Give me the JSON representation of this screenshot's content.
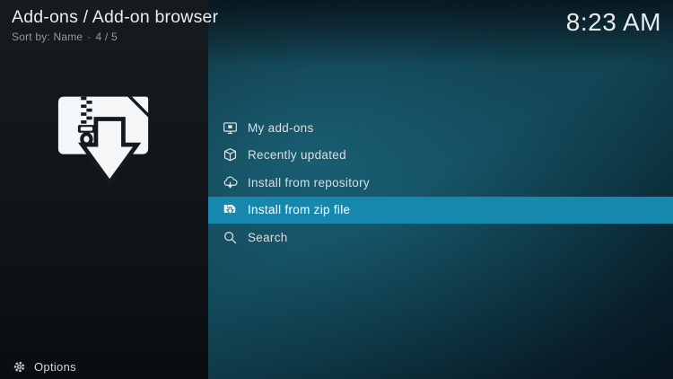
{
  "window": {
    "title": "Add-ons / Add-on browser",
    "sort_label": "Sort by: Name",
    "separator": "·",
    "position_indicator": "4 / 5",
    "clock": "8:23 AM"
  },
  "artwork": {
    "icon": "zip-file-download-icon"
  },
  "menu": {
    "items": [
      {
        "label": "My add-ons",
        "icon": "my-addons-icon",
        "selected": false
      },
      {
        "label": "Recently updated",
        "icon": "recently-updated-icon",
        "selected": false
      },
      {
        "label": "Install from repository",
        "icon": "install-from-repository-icon",
        "selected": false
      },
      {
        "label": "Install from zip file",
        "icon": "install-from-zip-icon",
        "selected": true
      },
      {
        "label": "Search",
        "icon": "search-icon",
        "selected": false
      }
    ]
  },
  "footer": {
    "options_label": "Options",
    "options_icon": "gear-icon"
  },
  "colors": {
    "highlight": "#1688ae",
    "left_panel": "#12171b",
    "menu_text": "#d9dfe2",
    "title_text": "#e9edef",
    "subtitle_text": "#929ba1"
  }
}
